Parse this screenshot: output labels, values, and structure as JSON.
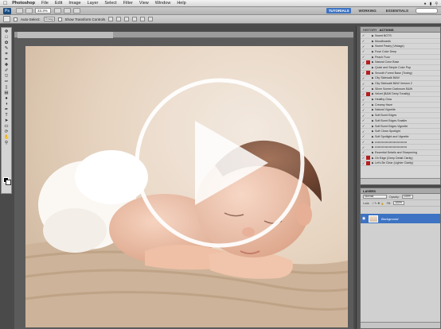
{
  "menubar": {
    "app_name": "Photoshop",
    "menus": [
      "File",
      "Edit",
      "Image",
      "Layer",
      "Select",
      "Filter",
      "View",
      "Window",
      "Help"
    ]
  },
  "appbar": {
    "zoom": "33.3%",
    "workspaces": [
      "TUTORIALS",
      "WORKING",
      "ESSENTIALS"
    ],
    "active_workspace": "TUTORIALS"
  },
  "options": {
    "auto_select_label": "Auto-Select:",
    "auto_select_value": "Group",
    "transform_label": "Show Transform Controls"
  },
  "actions_panel": {
    "tabs": [
      "HISTORY",
      "ACTIONS"
    ],
    "active_tab": "ACTIONS",
    "items": [
      {
        "name": "Sweet BOTS",
        "dialog": false
      },
      {
        "name": "Moodboards",
        "dialog": false
      },
      {
        "name": "Sweet Pastry (Vintage)",
        "dialog": false
      },
      {
        "name": "Fuse Color Deep",
        "dialog": false
      },
      {
        "name": "Peach Fuzz",
        "dialog": false
      },
      {
        "name": "Natural Color Base",
        "dialog": true
      },
      {
        "name": "Quick and Simple Color Pop",
        "dialog": false
      },
      {
        "name": "Smooth Forest Base (Toning)",
        "dialog": true
      },
      {
        "name": "City Sidewalk B&W",
        "dialog": false
      },
      {
        "name": "City Sidewalk B&W Version 2",
        "dialog": false
      },
      {
        "name": "Silver Screen Darkroom B&W",
        "dialog": false
      },
      {
        "name": "Velvet (B&W Deep Tonality)",
        "dialog": true
      },
      {
        "name": "Healthy Glow",
        "dialog": false
      },
      {
        "name": "Creamy Haze",
        "dialog": false
      },
      {
        "name": "Natural Vignette",
        "dialog": false
      },
      {
        "name": "Soft Burnt Edges",
        "dialog": false
      },
      {
        "name": "Soft Burnt Edges Smaller",
        "dialog": false
      },
      {
        "name": "Soft Burnt Edges Vignette",
        "dialog": false
      },
      {
        "name": "Soft Clean Spotlight",
        "dialog": false
      },
      {
        "name": "Soft Spotlight and Vignette",
        "dialog": false
      },
      {
        "name": "••••••••••••••••••••••••••••••••",
        "dialog": false
      },
      {
        "name": "••••••••••••••••••••••••••••••••",
        "dialog": false
      },
      {
        "name": "Essential Details and Sharpening",
        "dialog": false
      },
      {
        "name": "On Edge (Deep Detail Clarity)",
        "dialog": true
      },
      {
        "name": "Let's Be Clear (Lighter Clarity)",
        "dialog": true
      }
    ]
  },
  "layers_panel": {
    "tab": "LAYERS",
    "blend_mode": "Normal",
    "opacity_label": "Opacity:",
    "opacity": "100%",
    "lock_label": "Lock:",
    "fill_label": "Fill:",
    "fill": "100%",
    "layer_name": "Background"
  },
  "colors": {
    "accent": "#3d73c2",
    "dialog_red": "#b41e1e"
  }
}
